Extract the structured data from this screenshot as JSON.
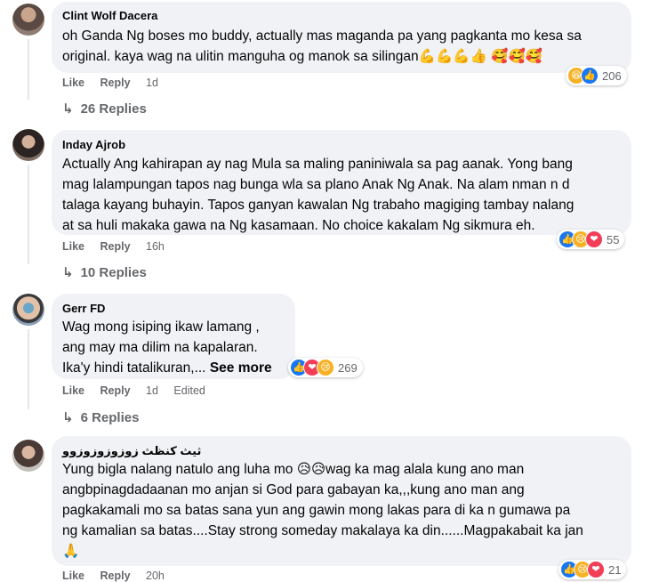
{
  "comments": [
    {
      "author": "Clint Wolf Dacera",
      "lines": [
        "oh Ganda Ng boses mo buddy, actually mas maganda pa yang pagkanta mo kesa sa",
        "original. kaya wag na ulitin manguha og manok sa silingan💪💪💪👍 🥰🥰🥰"
      ],
      "actions": {
        "like": "Like",
        "reply": "Reply",
        "time": "1d"
      },
      "reaction_count": "206",
      "replies": "26 Replies"
    },
    {
      "author": "Inday Ajrob",
      "lines": [
        "Actually Ang kahirapan ay nag Mula sa maling paniniwala sa pag aanak. Yong bang",
        "mag lalampungan tapos nag bunga wla sa plano Anak Ng Anak. Na alam nman n d",
        "talaga kayang buhayin. Tapos ganyan kawalan Ng trabaho magiging tambay nalang",
        "at sa huli makaka gawa na Ng kasamaan. No choice kakalam Ng sikmura eh."
      ],
      "actions": {
        "like": "Like",
        "reply": "Reply",
        "time": "16h"
      },
      "reaction_count": "55",
      "replies": "10 Replies"
    },
    {
      "author": "Gerr FD",
      "lines": [
        "Wag mong isiping ikaw lamang ,",
        "ang may ma dilim na kapalaran.",
        "Ika'y hindi tatalikuran,..."
      ],
      "see_more": "See more",
      "actions": {
        "like": "Like",
        "reply": "Reply",
        "time": "1d",
        "edited": "Edited"
      },
      "reaction_count": "269",
      "replies": "6 Replies"
    },
    {
      "author": "ثيث كنظث زوزوزوزوزوو",
      "lines": [
        "Yung bigla nalang natulo ang luha mo 😥😥wag ka mag alala kung ano man",
        "angbpinagdadaanan mo anjan si God para gabayan ka,,,kung ano man ang",
        "pagkakamali mo sa batas sana yun ang gawin mong lakas para di ka n gumawa pa",
        "ng kamalian sa batas....Stay strong someday makalaya ka din......Magpakabait ka jan",
        "🙏"
      ],
      "actions": {
        "like": "Like",
        "reply": "Reply",
        "time": "20h"
      },
      "reaction_count": "21"
    }
  ]
}
